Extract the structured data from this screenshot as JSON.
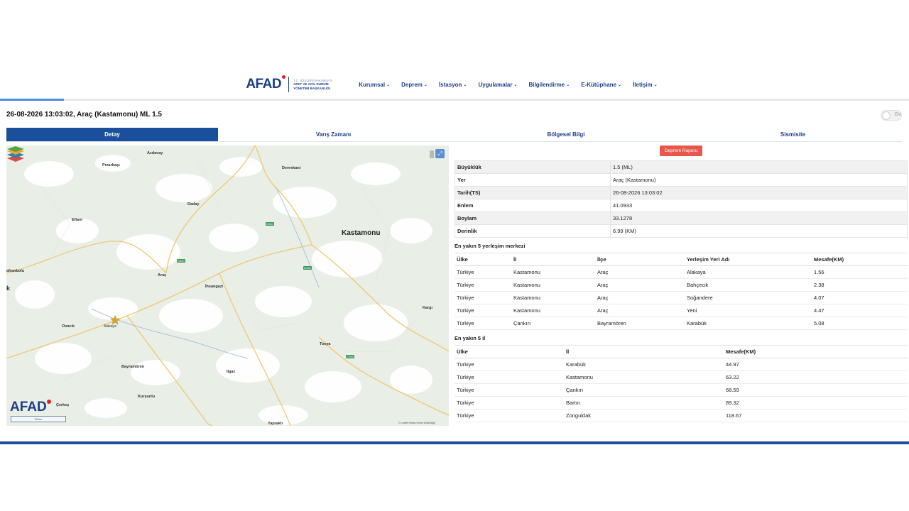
{
  "header": {
    "logo_text": "AFAD",
    "logo_sub_lines": [
      "T.C. İÇİŞLERİ BAKANLIĞI",
      "AFET VE ACİL DURUM",
      "YÖNETİMİ BAŞKANLIĞI"
    ],
    "nav": [
      "Kurumsal",
      "Deprem",
      "İstasyon",
      "Uygulamalar",
      "Bilgilendirme",
      "E-Kütüphane",
      "İletişim"
    ]
  },
  "page_title": "26-08-2026 13:03:02, Araç (Kastamonu) ML 1.5",
  "toggle_label": "EN",
  "tabs": [
    "Detay",
    "Varış Zamanı",
    "Bölgesel Bilgi",
    "Sismisite"
  ],
  "report_button": "Deprem Raporu",
  "info": [
    {
      "k": "Büyüklük",
      "v": "1.5 (ML)"
    },
    {
      "k": "Yer",
      "v": "Araç (Kastamonu)"
    },
    {
      "k": "Tarih(TS)",
      "v": "26-08-2026 13:03:02"
    },
    {
      "k": "Enlem",
      "v": "41.0933"
    },
    {
      "k": "Boylam",
      "v": "33.1278"
    },
    {
      "k": "Derinlik",
      "v": "6.99 (KM)"
    }
  ],
  "settlements": {
    "title": "En yakın 5 yerleşim merkezi",
    "headers": [
      "Ülke",
      "İl",
      "İlçe",
      "Yerleşim Yeri Adı",
      "Mesafe(KM)"
    ],
    "rows": [
      [
        "Türkiye",
        "Kastamonu",
        "Araç",
        "Alakaya",
        "1.56"
      ],
      [
        "Türkiye",
        "Kastamonu",
        "Araç",
        "Bahçecik",
        "2.38"
      ],
      [
        "Türkiye",
        "Kastamonu",
        "Araç",
        "Soğandere",
        "4.07"
      ],
      [
        "Türkiye",
        "Kastamonu",
        "Araç",
        "Yeni",
        "4.47"
      ],
      [
        "Türkiye",
        "Çankırı",
        "Bayramören",
        "Karabük",
        "5.08"
      ]
    ]
  },
  "provinces": {
    "title": "En yakın 5 il",
    "headers": [
      "Ülke",
      "İl",
      "Mesafe(KM)"
    ],
    "rows": [
      [
        "Türkiye",
        "Karabük",
        "44.97"
      ],
      [
        "Türkiye",
        "Kastamonu",
        "63.22"
      ],
      [
        "Türkiye",
        "Çankırı",
        "68.59"
      ],
      [
        "Türkiye",
        "Bartın",
        "89.32"
      ],
      [
        "Türkiye",
        "Zonguldak",
        "118.67"
      ]
    ]
  },
  "map": {
    "logo": "AFAD",
    "scale": "20 km",
    "attribution": "© Leaflet Harita Genel Müdürlüğü",
    "places": {
      "azdavay": "Azdavay",
      "pinarbasi": "Pınarbaşı",
      "devrekani": "Devrekani",
      "daday": "Daday",
      "kastamonu": "Kastamonu",
      "eflani": "Eflani",
      "arac": "Araç",
      "ihsangazi": "İhsangazi",
      "ovacik": "Ovacık",
      "alakaya": "Alakaya",
      "bayramoren": "Bayramören",
      "kursunlu": "Kurşunlu",
      "cerkes": "Çerkeş",
      "ilgaz": "Ilgaz",
      "tosya": "Tosya",
      "yaprakli": "Yapraklı",
      "kargi": "Kargı",
      "safranbolu": "afranbolu",
      "k": "k"
    }
  }
}
